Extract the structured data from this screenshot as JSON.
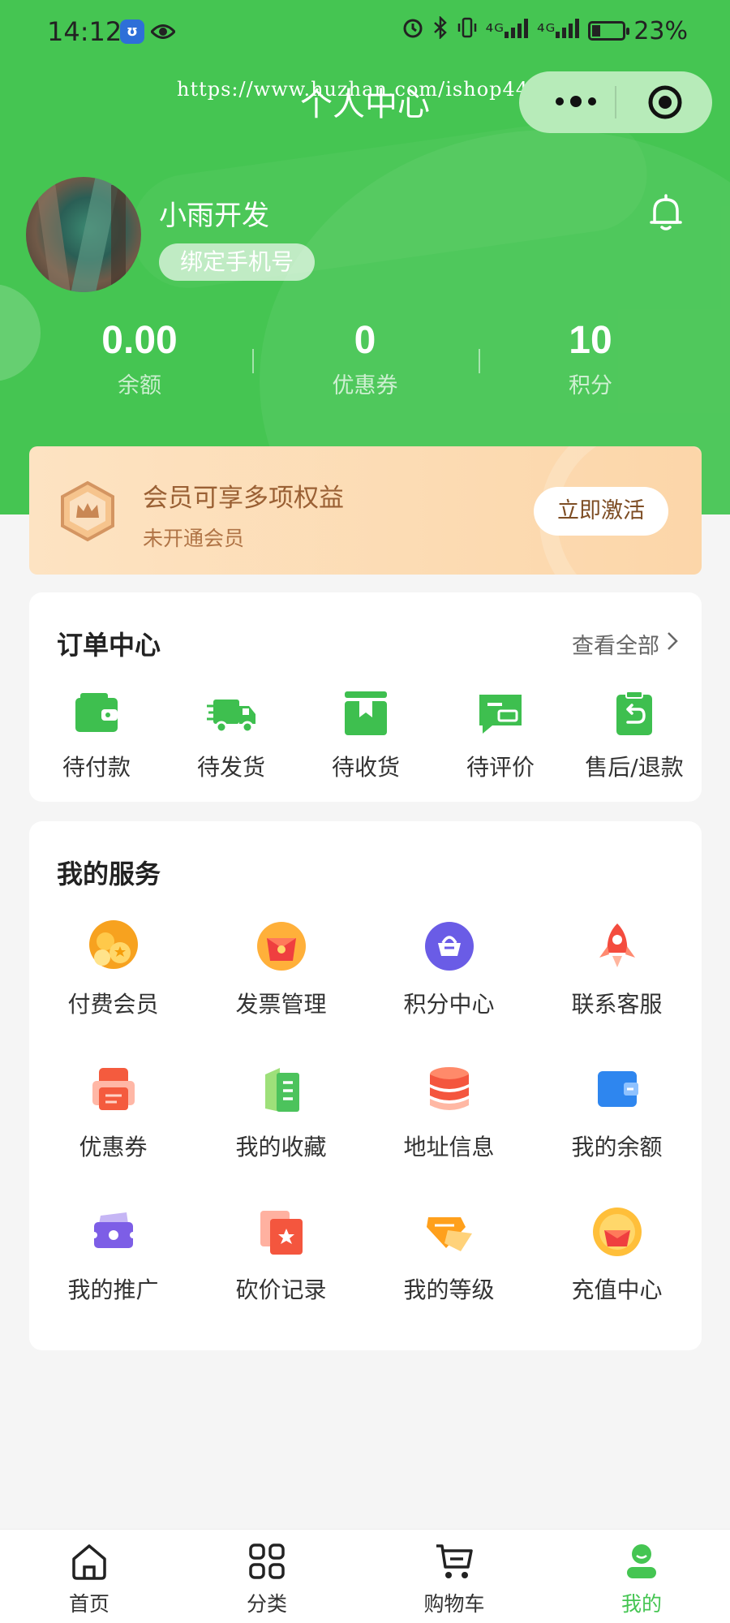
{
  "status_bar": {
    "time": "14:12",
    "app_badge": "ʊ",
    "signal_1": "⁴ᴳ",
    "signal_2": "⁴ᴳ",
    "battery_percent": "23%"
  },
  "header": {
    "title": "个人中心",
    "watermark": "https://www.huzhan.com/ishop44453"
  },
  "profile": {
    "username": "小雨开发",
    "bind_phone_label": "绑定手机号"
  },
  "stats": [
    {
      "value": "0.00",
      "label": "余额"
    },
    {
      "value": "0",
      "label": "优惠券"
    },
    {
      "value": "10",
      "label": "积分"
    }
  ],
  "member": {
    "title": "会员可享多项权益",
    "subtitle": "未开通会员",
    "activate_label": "立即激活"
  },
  "orders": {
    "title": "订单中心",
    "view_all": "查看全部",
    "items": [
      {
        "label": "待付款",
        "icon": "wallet-icon"
      },
      {
        "label": "待发货",
        "icon": "truck-icon"
      },
      {
        "label": "待收货",
        "icon": "package-icon"
      },
      {
        "label": "待评价",
        "icon": "comment-icon"
      },
      {
        "label": "售后/退款",
        "icon": "refund-icon"
      }
    ]
  },
  "services": {
    "title": "我的服务",
    "items": [
      {
        "label": "付费会员",
        "icon": "coins-icon"
      },
      {
        "label": "发票管理",
        "icon": "invoice-icon"
      },
      {
        "label": "积分中心",
        "icon": "basket-icon"
      },
      {
        "label": "联系客服",
        "icon": "rocket-icon"
      },
      {
        "label": "优惠券",
        "icon": "coupon-icon"
      },
      {
        "label": "我的收藏",
        "icon": "favorites-icon"
      },
      {
        "label": "地址信息",
        "icon": "database-icon"
      },
      {
        "label": "我的余额",
        "icon": "balance-wallet-icon"
      },
      {
        "label": "我的推广",
        "icon": "promotion-icon"
      },
      {
        "label": "砍价记录",
        "icon": "bargain-icon"
      },
      {
        "label": "我的等级",
        "icon": "level-gem-icon"
      },
      {
        "label": "充值中心",
        "icon": "recharge-icon"
      }
    ]
  },
  "tabbar": {
    "items": [
      {
        "label": "首页",
        "icon": "home-icon"
      },
      {
        "label": "分类",
        "icon": "grid-icon"
      },
      {
        "label": "购物车",
        "icon": "cart-icon"
      },
      {
        "label": "我的",
        "icon": "user-icon",
        "active": true
      }
    ]
  },
  "colors": {
    "brand_green": "#45c552",
    "member_gold": "#9a6034",
    "background": "#f5f5f5"
  }
}
